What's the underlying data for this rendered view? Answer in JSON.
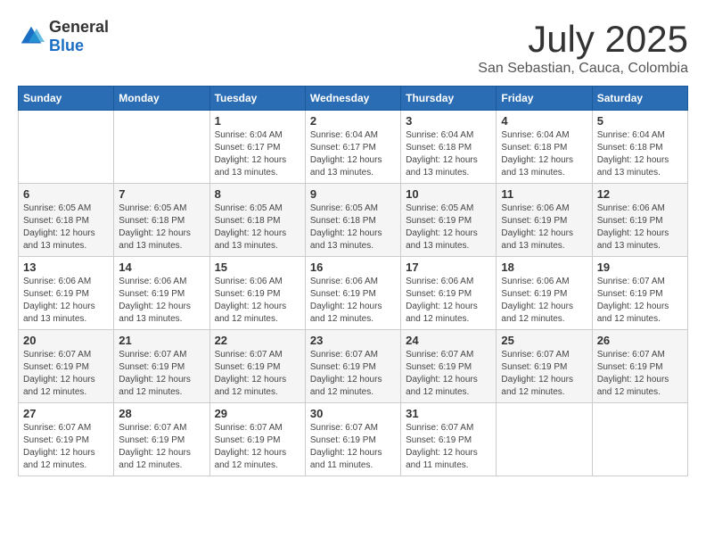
{
  "header": {
    "logo_general": "General",
    "logo_blue": "Blue",
    "month_title": "July 2025",
    "subtitle": "San Sebastian, Cauca, Colombia"
  },
  "weekdays": [
    "Sunday",
    "Monday",
    "Tuesday",
    "Wednesday",
    "Thursday",
    "Friday",
    "Saturday"
  ],
  "weeks": [
    [
      {
        "day": "",
        "info": ""
      },
      {
        "day": "",
        "info": ""
      },
      {
        "day": "1",
        "info": "Sunrise: 6:04 AM\nSunset: 6:17 PM\nDaylight: 12 hours and 13 minutes."
      },
      {
        "day": "2",
        "info": "Sunrise: 6:04 AM\nSunset: 6:17 PM\nDaylight: 12 hours and 13 minutes."
      },
      {
        "day": "3",
        "info": "Sunrise: 6:04 AM\nSunset: 6:18 PM\nDaylight: 12 hours and 13 minutes."
      },
      {
        "day": "4",
        "info": "Sunrise: 6:04 AM\nSunset: 6:18 PM\nDaylight: 12 hours and 13 minutes."
      },
      {
        "day": "5",
        "info": "Sunrise: 6:04 AM\nSunset: 6:18 PM\nDaylight: 12 hours and 13 minutes."
      }
    ],
    [
      {
        "day": "6",
        "info": "Sunrise: 6:05 AM\nSunset: 6:18 PM\nDaylight: 12 hours and 13 minutes."
      },
      {
        "day": "7",
        "info": "Sunrise: 6:05 AM\nSunset: 6:18 PM\nDaylight: 12 hours and 13 minutes."
      },
      {
        "day": "8",
        "info": "Sunrise: 6:05 AM\nSunset: 6:18 PM\nDaylight: 12 hours and 13 minutes."
      },
      {
        "day": "9",
        "info": "Sunrise: 6:05 AM\nSunset: 6:18 PM\nDaylight: 12 hours and 13 minutes."
      },
      {
        "day": "10",
        "info": "Sunrise: 6:05 AM\nSunset: 6:19 PM\nDaylight: 12 hours and 13 minutes."
      },
      {
        "day": "11",
        "info": "Sunrise: 6:06 AM\nSunset: 6:19 PM\nDaylight: 12 hours and 13 minutes."
      },
      {
        "day": "12",
        "info": "Sunrise: 6:06 AM\nSunset: 6:19 PM\nDaylight: 12 hours and 13 minutes."
      }
    ],
    [
      {
        "day": "13",
        "info": "Sunrise: 6:06 AM\nSunset: 6:19 PM\nDaylight: 12 hours and 13 minutes."
      },
      {
        "day": "14",
        "info": "Sunrise: 6:06 AM\nSunset: 6:19 PM\nDaylight: 12 hours and 13 minutes."
      },
      {
        "day": "15",
        "info": "Sunrise: 6:06 AM\nSunset: 6:19 PM\nDaylight: 12 hours and 12 minutes."
      },
      {
        "day": "16",
        "info": "Sunrise: 6:06 AM\nSunset: 6:19 PM\nDaylight: 12 hours and 12 minutes."
      },
      {
        "day": "17",
        "info": "Sunrise: 6:06 AM\nSunset: 6:19 PM\nDaylight: 12 hours and 12 minutes."
      },
      {
        "day": "18",
        "info": "Sunrise: 6:06 AM\nSunset: 6:19 PM\nDaylight: 12 hours and 12 minutes."
      },
      {
        "day": "19",
        "info": "Sunrise: 6:07 AM\nSunset: 6:19 PM\nDaylight: 12 hours and 12 minutes."
      }
    ],
    [
      {
        "day": "20",
        "info": "Sunrise: 6:07 AM\nSunset: 6:19 PM\nDaylight: 12 hours and 12 minutes."
      },
      {
        "day": "21",
        "info": "Sunrise: 6:07 AM\nSunset: 6:19 PM\nDaylight: 12 hours and 12 minutes."
      },
      {
        "day": "22",
        "info": "Sunrise: 6:07 AM\nSunset: 6:19 PM\nDaylight: 12 hours and 12 minutes."
      },
      {
        "day": "23",
        "info": "Sunrise: 6:07 AM\nSunset: 6:19 PM\nDaylight: 12 hours and 12 minutes."
      },
      {
        "day": "24",
        "info": "Sunrise: 6:07 AM\nSunset: 6:19 PM\nDaylight: 12 hours and 12 minutes."
      },
      {
        "day": "25",
        "info": "Sunrise: 6:07 AM\nSunset: 6:19 PM\nDaylight: 12 hours and 12 minutes."
      },
      {
        "day": "26",
        "info": "Sunrise: 6:07 AM\nSunset: 6:19 PM\nDaylight: 12 hours and 12 minutes."
      }
    ],
    [
      {
        "day": "27",
        "info": "Sunrise: 6:07 AM\nSunset: 6:19 PM\nDaylight: 12 hours and 12 minutes."
      },
      {
        "day": "28",
        "info": "Sunrise: 6:07 AM\nSunset: 6:19 PM\nDaylight: 12 hours and 12 minutes."
      },
      {
        "day": "29",
        "info": "Sunrise: 6:07 AM\nSunset: 6:19 PM\nDaylight: 12 hours and 12 minutes."
      },
      {
        "day": "30",
        "info": "Sunrise: 6:07 AM\nSunset: 6:19 PM\nDaylight: 12 hours and 11 minutes."
      },
      {
        "day": "31",
        "info": "Sunrise: 6:07 AM\nSunset: 6:19 PM\nDaylight: 12 hours and 11 minutes."
      },
      {
        "day": "",
        "info": ""
      },
      {
        "day": "",
        "info": ""
      }
    ]
  ]
}
